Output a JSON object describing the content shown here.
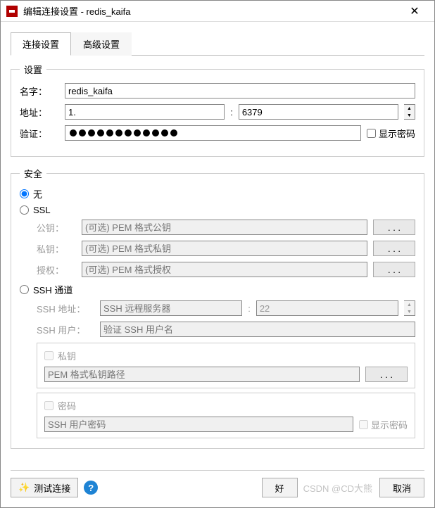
{
  "title": "编辑连接设置 - redis_kaifa",
  "tabs": {
    "connection": "连接设置",
    "advanced": "高级设置"
  },
  "group_settings": {
    "legend": "设置",
    "name_label": "名字：",
    "name_value": "redis_kaifa",
    "addr_label": "地址：",
    "addr_value": "1.",
    "port_value": "6379",
    "auth_label": "验证：",
    "show_password": "显示密码"
  },
  "group_security": {
    "legend": "安全",
    "opt_none": "无",
    "opt_ssl": "SSL",
    "ssl_pubkey_label": "公钥：",
    "ssl_pubkey_ph": "(可选) PEM 格式公钥",
    "ssl_privkey_label": "私钥：",
    "ssl_privkey_ph": "(可选) PEM 格式私钥",
    "ssl_auth_label": "授权：",
    "ssl_auth_ph": "(可选) PEM 格式授权",
    "opt_ssh": "SSH 通道",
    "ssh_addr_label": "SSH 地址：",
    "ssh_addr_ph": "SSH 远程服务器",
    "ssh_port_value": "22",
    "ssh_user_label": "SSH 用户：",
    "ssh_user_ph": "验证 SSH 用户名",
    "ssh_priv_legend": "私钥",
    "ssh_priv_ph": "PEM 格式私钥路径",
    "ssh_pass_legend": "密码",
    "ssh_pass_ph": "SSH 用户密码",
    "ssh_show_password": "显示密码",
    "ellipsis": ". . ."
  },
  "buttons": {
    "test": "测试连接",
    "ok": "好",
    "cancel": "取消"
  },
  "watermark": "CSDN @CD大熊"
}
